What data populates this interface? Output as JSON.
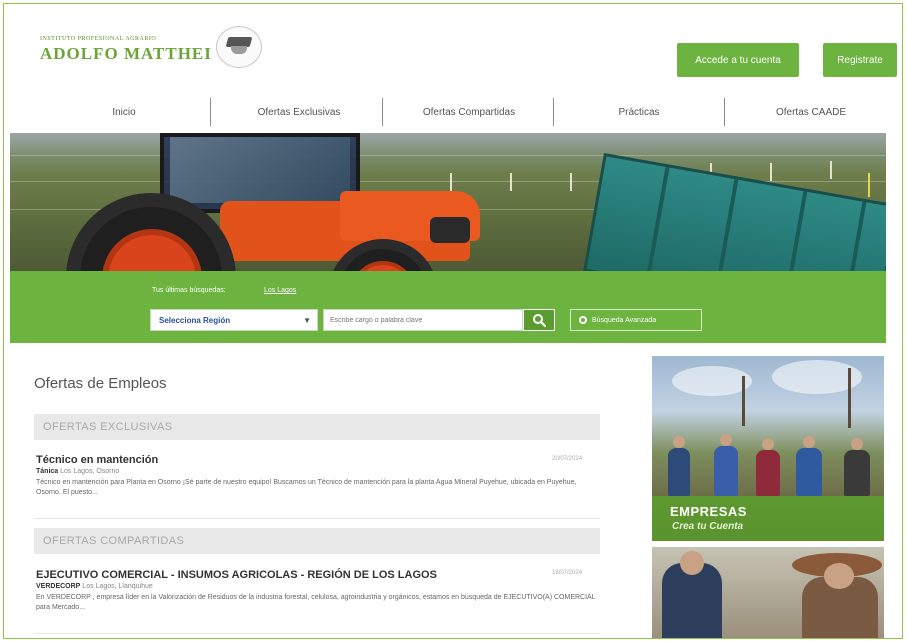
{
  "header": {
    "logo_top": "INSTITUTO PROFESIONAL AGRARIO",
    "logo_name": "ADOLFO MATTHEI",
    "login_label": "Accede a tu cuenta",
    "register_label": "Registrate"
  },
  "nav": {
    "items": [
      "Inicio",
      "Ofertas Exclusivas",
      "Ofertas Compartidas",
      "Prácticas",
      "Ofertas CAADE"
    ]
  },
  "search": {
    "recent_label": "Tus últimas búsquedas:",
    "recent_link": "Los Lagos",
    "region_selected": "Selecciona Región",
    "keyword_placeholder": "Escribe cargo o palabra clave",
    "advanced_label": "Búsqueda Avanzada"
  },
  "content": {
    "title": "Ofertas de Empleos",
    "exclusive_header": "OFERTAS EXCLUSIVAS",
    "shared_header": "OFERTAS COMPARTIDAS",
    "exclusive_job": {
      "title": "Técnico en mantención",
      "date": "20/07/2024",
      "company": "Tánica",
      "location": "Los Lagos, Osorno",
      "description": "Técnico en mantención para Planta en Osorno ¡Sé parte de nuestro equipo! Buscamos un Técnico de mantención para la planta Agua Mineral Puyehue, ubicada en Puyehue, Osorno. El puesto..."
    },
    "shared_job": {
      "title": "EJECUTIVO COMERCIAL - INSUMOS AGRICOLAS - REGIÓN DE LOS LAGOS",
      "date": "18/07/2024",
      "company": "VERDECORP",
      "location": "Los Lagos, Llanquihue",
      "description": "En VERDECORP , empresa líder en la Valorización de Residuos de la industria forestal, celulosa, agroindustria y orgánicos, estamos en búsqueda de EJECUTIVO(A) COMERCIAL para Mercado..."
    }
  },
  "sidebar": {
    "empresas_title": "EMPRESAS",
    "empresas_sub": "Crea tu Cuenta"
  },
  "colors": {
    "brand_green": "#6db33f",
    "link_blue": "#2a4fa0"
  }
}
